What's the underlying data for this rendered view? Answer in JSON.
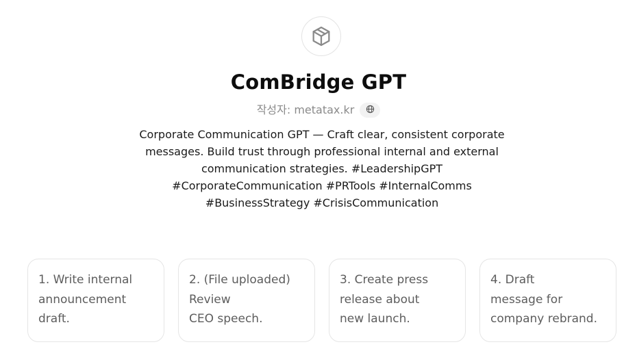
{
  "gpt": {
    "name": "ComBridge GPT",
    "author_prefix": "작성자: ",
    "author": "metatax.kr",
    "author_link_icon": "globe-icon",
    "avatar_icon": "cube-icon",
    "description": "Corporate Communication GPT — Craft clear, consistent corporate messages. Build trust through professional internal and external communication strategies. #LeadershipGPT #CorporateCommunication #PRTools #InternalComms #BusinessStrategy #CrisisCommunication"
  },
  "starters": [
    {
      "text": "1. Write internal\nannouncement\ndraft."
    },
    {
      "text": "2. (File uploaded)\nReview\nCEO speech."
    },
    {
      "text": "3. Create press\nrelease about\nnew launch."
    },
    {
      "text": "4. Draft\nmessage for\ncompany rebrand."
    }
  ]
}
